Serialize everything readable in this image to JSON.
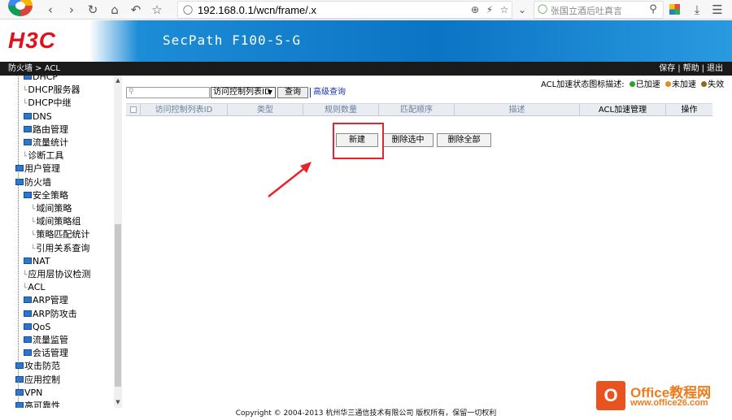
{
  "browser": {
    "address": "192.168.0.1/wcn/frame/.x",
    "search_placeholder": "张国立酒后吐真言"
  },
  "header": {
    "brand": "H3C",
    "product": "SecPath F100-S-G"
  },
  "nav": {
    "breadcrumb": "防火墙 > ACL",
    "links": [
      "保存",
      "帮助",
      "退出"
    ]
  },
  "sidebar": {
    "items": [
      {
        "label": "DHCP",
        "folder": true
      },
      {
        "label": "DHCP服务器",
        "folder": false
      },
      {
        "label": "DHCP中继",
        "folder": false
      },
      {
        "label": "DNS",
        "folder": true
      },
      {
        "label": "路由管理",
        "folder": true
      },
      {
        "label": "流量统计",
        "folder": true
      },
      {
        "label": "诊断工具",
        "folder": false
      },
      {
        "label": "用户管理",
        "folder": true
      },
      {
        "label": "防火墙",
        "folder": true
      },
      {
        "label": "安全策略",
        "folder": true
      },
      {
        "label": "域间策略",
        "folder": false
      },
      {
        "label": "域间策略组",
        "folder": false
      },
      {
        "label": "策略匹配统计",
        "folder": false
      },
      {
        "label": "引用关系查询",
        "folder": false
      },
      {
        "label": "NAT",
        "folder": true
      },
      {
        "label": "应用层协议检测",
        "folder": false
      },
      {
        "label": "ACL",
        "folder": false
      },
      {
        "label": "ARP管理",
        "folder": true
      },
      {
        "label": "ARP防攻击",
        "folder": true
      },
      {
        "label": "QoS",
        "folder": true
      },
      {
        "label": "流量监管",
        "folder": true
      },
      {
        "label": "会话管理",
        "folder": true
      },
      {
        "label": "攻击防范",
        "folder": true
      },
      {
        "label": "应用控制",
        "folder": true
      },
      {
        "label": "VPN",
        "folder": true
      },
      {
        "label": "高可靠性",
        "folder": true
      }
    ]
  },
  "main": {
    "legend": {
      "label": "ACL加速状态图标描述:",
      "items": [
        {
          "label": "已加速",
          "color": "#2e9e2e"
        },
        {
          "label": "未加速",
          "color": "#e8891c"
        },
        {
          "label": "失效",
          "color": "#8a6d1c"
        }
      ]
    },
    "filter": {
      "select": "访问控制列表ID",
      "query": "查询",
      "advanced": "高级查询"
    },
    "columns": [
      "访问控制列表ID",
      "类型",
      "规则数量",
      "匹配顺序",
      "描述",
      "ACL加速管理",
      "操作"
    ],
    "buttons": {
      "new": "新建",
      "delete_selected": "删除选中",
      "delete_all": "删除全部"
    }
  },
  "footer": "Copyright © 2004-2013 杭州华三通信技术有限公司 版权所有，保留一切权利",
  "watermark": {
    "title": "Office教程网",
    "url": "www.office26.com"
  }
}
